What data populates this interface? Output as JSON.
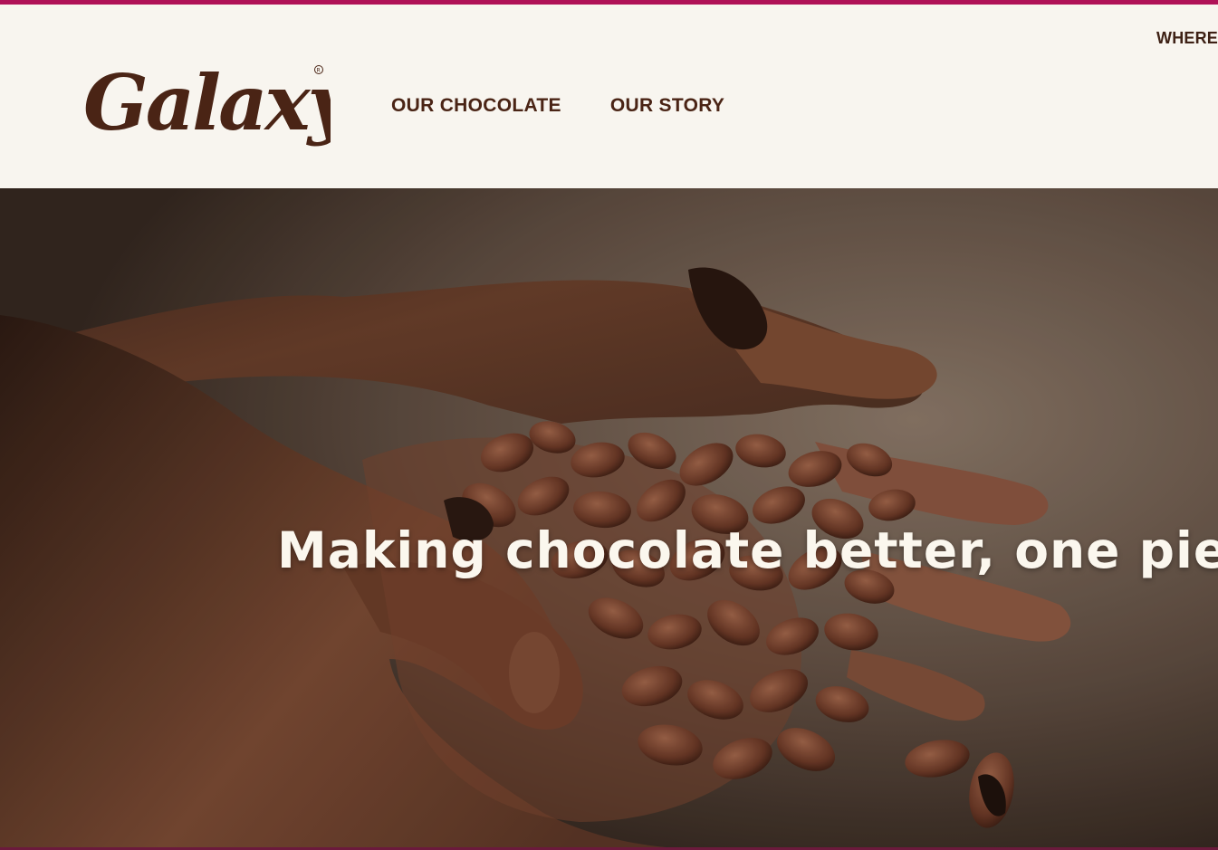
{
  "brand": {
    "logo_text": "Galaxy",
    "logo_mark": "®",
    "accent_color": "#b01257",
    "brand_brown": "#4a2415"
  },
  "header": {
    "nav": [
      {
        "label": "OUR CHOCOLATE"
      },
      {
        "label": "OUR STORY"
      }
    ],
    "utility_link": "WHERE"
  },
  "hero": {
    "headline": "Making chocolate better, one piece",
    "image_subject": "cupped-hands-cocoa-beans"
  }
}
